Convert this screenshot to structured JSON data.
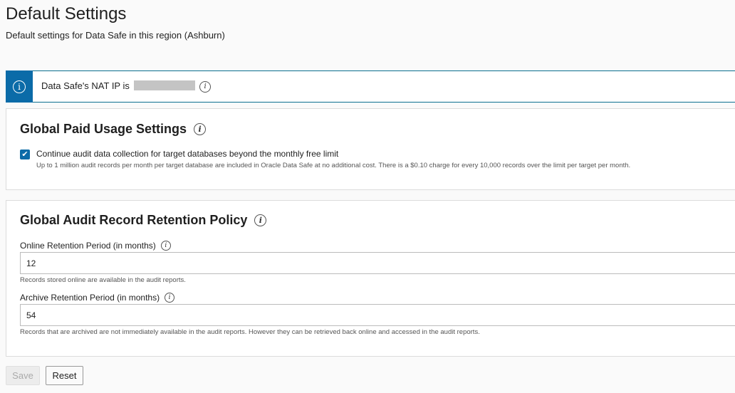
{
  "header": {
    "title": "Default Settings",
    "subtitle": "Default settings for Data Safe in this region (Ashburn)"
  },
  "banner": {
    "text": "Data Safe's NAT IP is"
  },
  "paid_usage": {
    "title": "Global Paid Usage Settings",
    "checkbox_checked": true,
    "checkbox_label": "Continue audit data collection for target databases beyond the monthly free limit",
    "checkbox_help": "Up to 1 million audit records per month per target database are included in Oracle Data Safe at no additional cost. There is a $0.10 charge for every 10,000 records over the limit per target per month."
  },
  "retention": {
    "title": "Global Audit Record Retention Policy",
    "online_label": "Online Retention Period (in months)",
    "online_value": "12",
    "online_help": "Records stored online are available in the audit reports.",
    "archive_label": "Archive Retention Period (in months)",
    "archive_value": "54",
    "archive_help": "Records that are archived are not immediately available in the audit reports. However they can be retrieved back online and accessed in the audit reports."
  },
  "actions": {
    "save_label": "Save",
    "reset_label": "Reset"
  },
  "colors": {
    "accent": "#0b6ba8",
    "banner_border": "#0b6f8f"
  },
  "icons": {
    "info": "info-circle-icon",
    "check": "checkmark-icon"
  }
}
